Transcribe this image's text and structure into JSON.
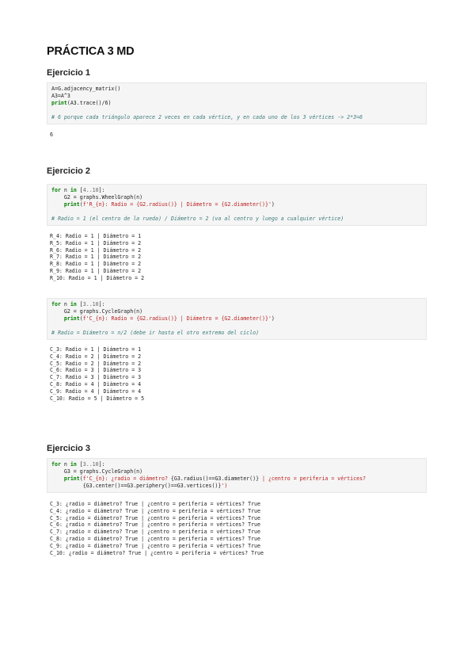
{
  "title": "PRÁCTICA 3 MD",
  "sections": [
    {
      "title": "Ejercicio 1",
      "cells": [
        {
          "code": [
            [
              {
                "t": "A=G.adjacency_matrix()",
                "c": ""
              }
            ],
            [
              {
                "t": "A3=A^3",
                "c": ""
              }
            ],
            [
              {
                "t": "print",
                "c": "kw"
              },
              {
                "t": "(A3.trace()/6)",
                "c": ""
              }
            ],
            [
              {
                "t": " ",
                "c": ""
              }
            ],
            [
              {
                "t": "# 6 porque cada triángulo aparece 2 veces en cada vértice, y en cada uno de los 3 vértices -> 2*3=6",
                "c": "cm"
              }
            ]
          ],
          "output": [
            "6"
          ]
        }
      ]
    },
    {
      "title": "Ejercicio 2",
      "cells": [
        {
          "code": [
            [
              {
                "t": "for",
                "c": "kw"
              },
              {
                "t": " n ",
                "c": ""
              },
              {
                "t": "in",
                "c": "kw"
              },
              {
                "t": " [",
                "c": ""
              },
              {
                "t": "4..10",
                "c": "num"
              },
              {
                "t": "]:",
                "c": ""
              }
            ],
            [
              {
                "t": "    G2 = graphs.WheelGraph(n)",
                "c": ""
              }
            ],
            [
              {
                "t": "    ",
                "c": ""
              },
              {
                "t": "print",
                "c": "kw"
              },
              {
                "t": "(",
                "c": ""
              },
              {
                "t": "f'R_{n}: Radio = {G2.radius()} | Diámetro = {G2.diameter()}'",
                "c": "str"
              },
              {
                "t": ")",
                "c": ""
              }
            ],
            [
              {
                "t": " ",
                "c": ""
              }
            ],
            [
              {
                "t": "# Radio = 1 (el centro de la rueda) / Diámetro = 2 (va al centro y luego a cualquier vértice)",
                "c": "cm"
              }
            ]
          ],
          "output": [
            "R_4: Radio = 1 | Diámetro = 1",
            "R_5: Radio = 1 | Diámetro = 2",
            "R_6: Radio = 1 | Diámetro = 2",
            "R_7: Radio = 1 | Diámetro = 2",
            "R_8: Radio = 1 | Diámetro = 2",
            "R_9: Radio = 1 | Diámetro = 2",
            "R_10: Radio = 1 | Diámetro = 2"
          ]
        },
        {
          "code": [
            [
              {
                "t": "for",
                "c": "kw"
              },
              {
                "t": " n ",
                "c": ""
              },
              {
                "t": "in",
                "c": "kw"
              },
              {
                "t": " [",
                "c": ""
              },
              {
                "t": "3..10",
                "c": "num"
              },
              {
                "t": "]:",
                "c": ""
              }
            ],
            [
              {
                "t": "    G2 = graphs.CycleGraph(n)",
                "c": ""
              }
            ],
            [
              {
                "t": "    ",
                "c": ""
              },
              {
                "t": "print",
                "c": "kw"
              },
              {
                "t": "(",
                "c": ""
              },
              {
                "t": "f'C_{n}: Radio = {G2.radius()} | Diámetro = {G2.diameter()}'",
                "c": "str"
              },
              {
                "t": ")",
                "c": ""
              }
            ],
            [
              {
                "t": " ",
                "c": ""
              }
            ],
            [
              {
                "t": "# Radio = Diámetro = n/2 (debe ir hasta el otro extremo del ciclo)",
                "c": "cm"
              }
            ]
          ],
          "output": [
            "C_3: Radio = 1 | Diámetro = 1",
            "C_4: Radio = 2 | Diámetro = 2",
            "C_5: Radio = 2 | Diámetro = 2",
            "C_6: Radio = 3 | Diámetro = 3",
            "C_7: Radio = 3 | Diámetro = 3",
            "C_8: Radio = 4 | Diámetro = 4",
            "C_9: Radio = 4 | Diámetro = 4",
            "C_10: Radio = 5 | Diámetro = 5"
          ]
        }
      ]
    },
    {
      "title": "Ejercicio 3",
      "cells": [
        {
          "code": [
            [
              {
                "t": "for",
                "c": "kw"
              },
              {
                "t": " n ",
                "c": ""
              },
              {
                "t": "in",
                "c": "kw"
              },
              {
                "t": " [",
                "c": ""
              },
              {
                "t": "3..10",
                "c": "num"
              },
              {
                "t": "]:",
                "c": ""
              }
            ],
            [
              {
                "t": "    G3 = graphs.CycleGraph(n)",
                "c": ""
              }
            ],
            [
              {
                "t": "    ",
                "c": ""
              },
              {
                "t": "print",
                "c": "kw"
              },
              {
                "t": "(",
                "c": ""
              },
              {
                "t": "f'C_{n}: ¿radio = diámetro? ",
                "c": "str"
              },
              {
                "t": "{G3.radius()==G3.diameter()}",
                "c": ""
              },
              {
                "t": " | ¿centro = periferia = vértices?",
                "c": "str"
              }
            ],
            [
              {
                "t": "          {G3.center()==G3.periphery()==G3.vertices()}",
                "c": ""
              },
              {
                "t": "')",
                "c": "str"
              }
            ]
          ],
          "output": [
            "C_3: ¿radio = diámetro? True | ¿centro = periferia = vértices? True",
            "C_4: ¿radio = diámetro? True | ¿centro = periferia = vértices? True",
            "C_5: ¿radio = diámetro? True | ¿centro = periferia = vértices? True",
            "C_6: ¿radio = diámetro? True | ¿centro = periferia = vértices? True",
            "C_7: ¿radio = diámetro? True | ¿centro = periferia = vértices? True",
            "C_8: ¿radio = diámetro? True | ¿centro = periferia = vértices? True",
            "C_9: ¿radio = diámetro? True | ¿centro = periferia = vértices? True",
            "C_10: ¿radio = diámetro? True | ¿centro = periferia = vértices? True"
          ]
        }
      ]
    }
  ]
}
